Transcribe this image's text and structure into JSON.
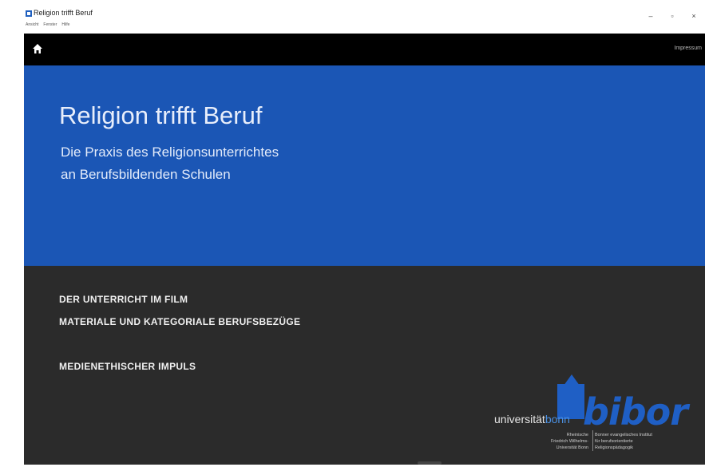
{
  "window": {
    "title": "Religion trifft Beruf",
    "menu": [
      "Ansicht",
      "Fenster",
      "Hilfe"
    ],
    "controls": {
      "minimize": "–",
      "restore": "▫",
      "close": "×"
    }
  },
  "navbar": {
    "home_icon": "home-icon",
    "impressum": "Impressum"
  },
  "hero": {
    "title": "Religion trifft Beruf",
    "subtitle_line1": "Die Praxis des Religionsunterrichtes",
    "subtitle_line2": "an Berufsbildenden Schulen"
  },
  "links": [
    "DER UNTERRICHT IM FILM",
    "MATERIALE UND KATEGORIALE BERUFSBEZÜGE",
    "MEDIENETHISCHER IMPULS"
  ],
  "logo": {
    "universitaet": "universität",
    "bonn": "bonn",
    "bibor": "bibor",
    "left_text": [
      "Rheinische",
      "Friedrich Wilhelms-",
      "Universität Bonn"
    ],
    "right_text": [
      "Bonner evangelisches Institut",
      "für berufsorientierte",
      "Religionspädagogik"
    ]
  },
  "colors": {
    "hero_blue": "#1b56b5",
    "dark_bg": "#2b2b2b",
    "navbar": "#000000"
  }
}
